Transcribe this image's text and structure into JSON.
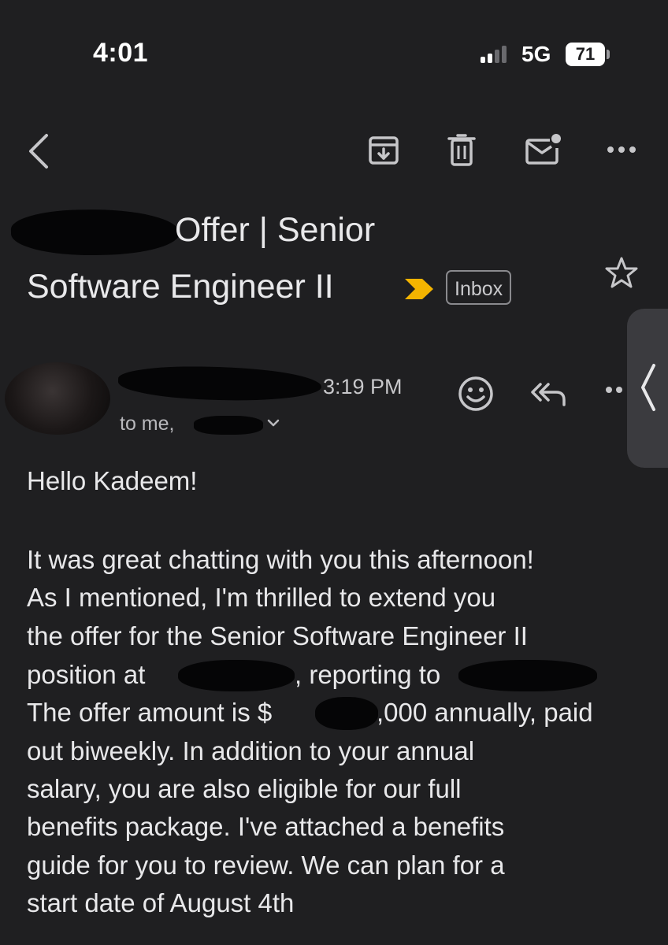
{
  "status_bar": {
    "time": "4:01",
    "network": "5G",
    "battery": "71"
  },
  "toolbar": {
    "back_icon": "chevron-left-icon",
    "archive_icon": "archive-icon",
    "delete_icon": "trash-icon",
    "mark_unread_icon": "mark-unread-icon",
    "more_icon": "more-horizontal-icon"
  },
  "email": {
    "subject_line1": "Offer | Senior",
    "subject_line2": "Software Engineer II",
    "label": "Inbox",
    "important_marker_color": "#f4b400",
    "sent_time": "3:19 PM",
    "to_text": "to me,",
    "greeting": "Hello Kadeem!",
    "body": {
      "l1": "It was great chatting with you this afternoon!",
      "l2": "As I mentioned, I'm thrilled to extend you",
      "l3": "the offer for the Senior Software Engineer II",
      "l4a": "position at",
      "l4b": ", reporting to",
      "l5a": "The offer amount is $",
      "l5b": ",000 annually, paid",
      "l6": "out biweekly. In addition to your annual",
      "l7": "salary, you are also eligible for our full",
      "l8": "benefits package. I've attached a benefits",
      "l9": "guide for you to review. We can plan for a",
      "l10": "start date of August 4th"
    }
  },
  "colors": {
    "background": "#1f1f21",
    "text": "#e8e8ea",
    "secondary_text": "#b9b9bd",
    "icon": "#c6c6c9"
  }
}
